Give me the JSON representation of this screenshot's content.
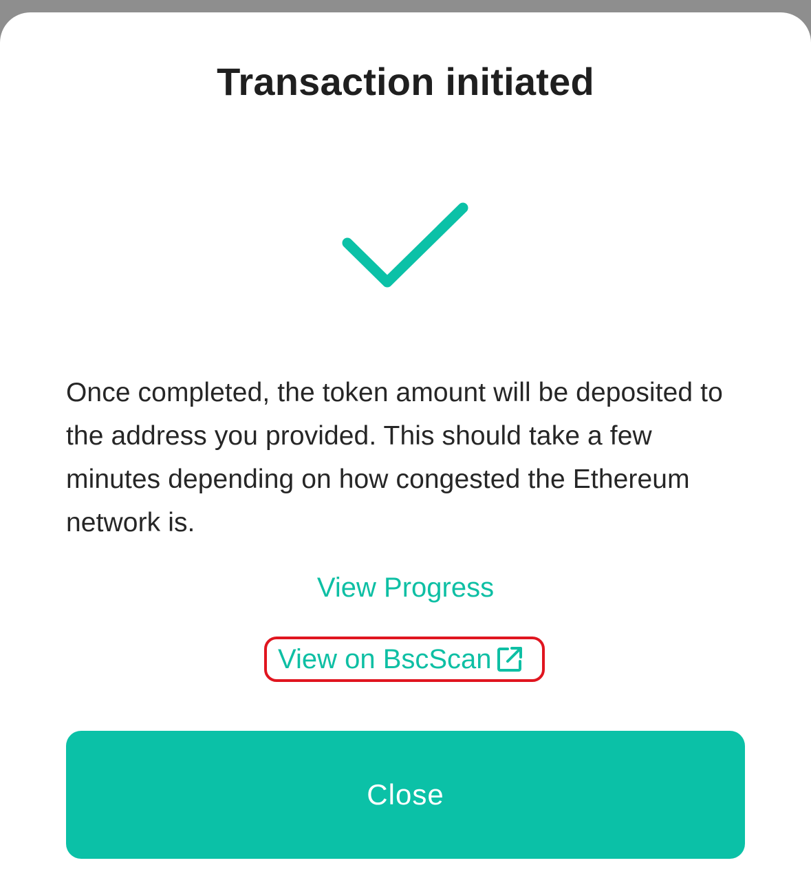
{
  "dialog": {
    "title": "Transaction initiated",
    "status_icon": "checkmark-icon",
    "message": "Once completed, the token amount will be deposited to the address you provided. This should take a few minutes depending on how congested the Ethereum network is.",
    "view_progress_label": "View Progress",
    "view_explorer_label": "View on BscScan",
    "external_link_icon": "external-link-icon",
    "close_label": "Close"
  },
  "colors": {
    "accent": "#0BC1A7",
    "highlight_border": "#E0151F",
    "title_text": "#1F1F1F",
    "body_text": "#262626",
    "backdrop": "#8E8E8E"
  }
}
